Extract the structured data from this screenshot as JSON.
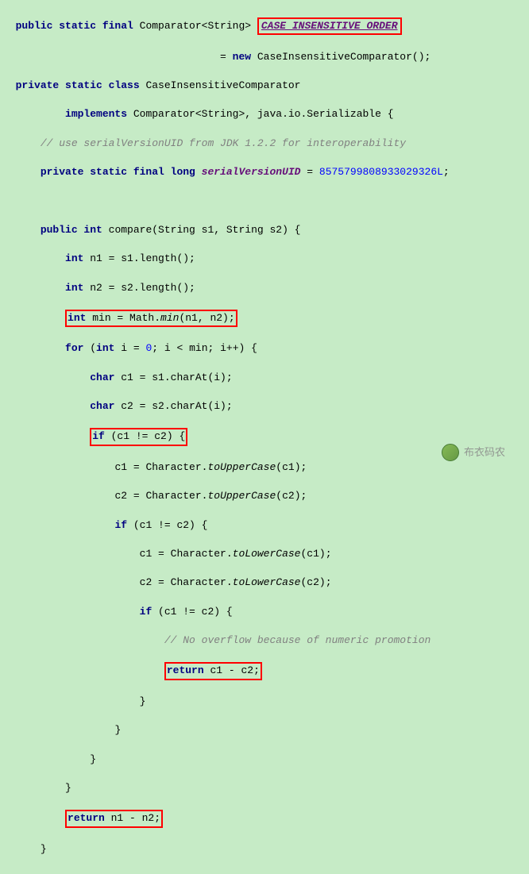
{
  "code": {
    "line1_a": "public static final ",
    "line1_b": "Comparator<String> ",
    "line1_box": "CASE_INSENSITIVE_ORDER",
    "line2_a": "= ",
    "line2_b": "new ",
    "line2_c": "CaseInsensitiveComparator();",
    "line3_a": "private static class ",
    "line3_b": "CaseInsensitiveComparator",
    "line4_a": "implements ",
    "line4_b": "Comparator<String>, java.io.Serializable {",
    "line5": "// use serialVersionUID from JDK 1.2.2 for interoperability",
    "line6_a": "private static final long ",
    "line6_b": "serialVersionUID",
    "line6_c": " = ",
    "line6_d": "8575799808933029326L",
    "line6_e": ";",
    "line8_a": "public int ",
    "line8_b": "compare(String s1, String s2) {",
    "line9_a": "int ",
    "line9_b": "n1 = s1.length();",
    "line10_a": "int ",
    "line10_b": "n2 = s2.length();",
    "line11_box_a": "int",
    "line11_box_b": " min = Math.",
    "line11_box_c": "min",
    "line11_box_d": "(n1, n2);",
    "line12_a": "for ",
    "line12_b": "(",
    "line12_c": "int ",
    "line12_d": "i = ",
    "line12_e": "0",
    "line12_f": "; i < min; i++) {",
    "line13_a": "char ",
    "line13_b": "c1 = s1.charAt(i);",
    "line14_a": "char ",
    "line14_b": "c2 = s2.charAt(i);",
    "line15_box_a": "if",
    "line15_box_b": " (c1 != c2) {",
    "line16_a": "c1 = Character.",
    "line16_b": "toUpperCase",
    "line16_c": "(c1);",
    "line17_a": "c2 = Character.",
    "line17_b": "toUpperCase",
    "line17_c": "(c2);",
    "line18_a": "if ",
    "line18_b": "(c1 != c2) {",
    "line19_a": "c1 = Character.",
    "line19_b": "toLowerCase",
    "line19_c": "(c1);",
    "line20_a": "c2 = Character.",
    "line20_b": "toLowerCase",
    "line20_c": "(c2);",
    "line21_a": "if ",
    "line21_b": "(c1 != c2) {",
    "line22": "// No overflow because of numeric promotion",
    "line23_box_a": "return",
    "line23_box_b": " c1 - c2;",
    "line24": "}",
    "line25": "}",
    "line26": "}",
    "line27": "}",
    "line28_box_a": "return",
    "line28_box_b": " n1 - n2;",
    "line29": "}"
  },
  "watermark": "布衣码农"
}
